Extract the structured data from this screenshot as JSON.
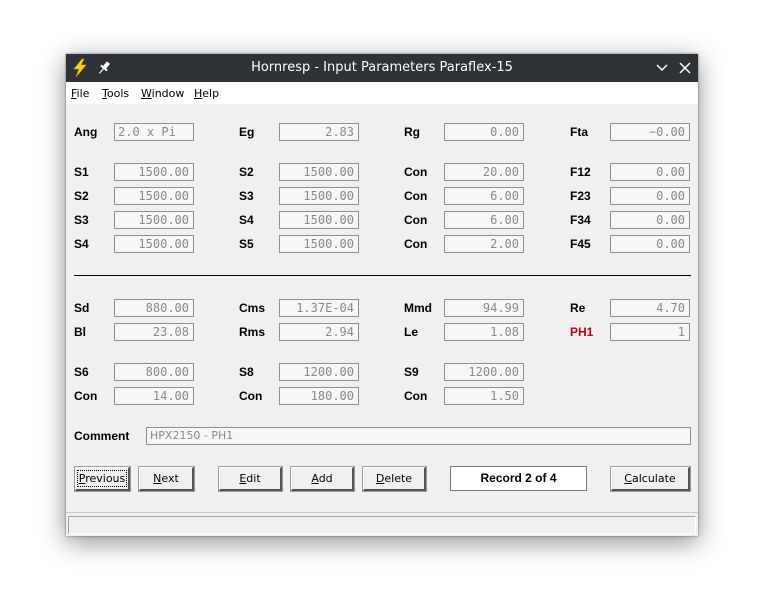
{
  "window": {
    "title": "Hornresp - Input Parameters Paraflex-15",
    "app_icon": "lightning-icon",
    "pin_icon": "pin-icon",
    "minimize_icon": "chevron-down-icon",
    "close_icon": "close-icon"
  },
  "menu": {
    "file": {
      "u": "F",
      "rest": "ile"
    },
    "tools": {
      "u": "T",
      "rest": "ools"
    },
    "window": {
      "u": "W",
      "rest": "indow"
    },
    "help": {
      "u": "H",
      "rest": "elp"
    }
  },
  "params": {
    "row1": [
      {
        "label": "Ang",
        "value": "2.0 x Pi"
      },
      {
        "label": "Eg",
        "value": "2.83"
      },
      {
        "label": "Rg",
        "value": "0.00"
      },
      {
        "label": "Fta",
        "value": "−0.00"
      }
    ],
    "row2": [
      {
        "label": "S1",
        "value": "1500.00"
      },
      {
        "label": "S2",
        "value": "1500.00"
      },
      {
        "label": "Con",
        "value": "20.00"
      },
      {
        "label": "F12",
        "value": "0.00"
      }
    ],
    "row3": [
      {
        "label": "S2",
        "value": "1500.00"
      },
      {
        "label": "S3",
        "value": "1500.00"
      },
      {
        "label": "Con",
        "value": "6.00"
      },
      {
        "label": "F23",
        "value": "0.00"
      }
    ],
    "row4": [
      {
        "label": "S3",
        "value": "1500.00"
      },
      {
        "label": "S4",
        "value": "1500.00"
      },
      {
        "label": "Con",
        "value": "6.00"
      },
      {
        "label": "F34",
        "value": "0.00"
      }
    ],
    "row5": [
      {
        "label": "S4",
        "value": "1500.00"
      },
      {
        "label": "S5",
        "value": "1500.00"
      },
      {
        "label": "Con",
        "value": "2.00"
      },
      {
        "label": "F45",
        "value": "0.00"
      }
    ],
    "row6": [
      {
        "label": "Sd",
        "value": "880.00"
      },
      {
        "label": "Cms",
        "value": "1.37E-04"
      },
      {
        "label": "Mmd",
        "value": "94.99"
      },
      {
        "label": "Re",
        "value": "4.70"
      }
    ],
    "row7": [
      {
        "label": "Bl",
        "value": "23.08"
      },
      {
        "label": "Rms",
        "value": "2.94"
      },
      {
        "label": "Le",
        "value": "1.08"
      },
      {
        "label": "PH1",
        "value": "1"
      }
    ],
    "row8": [
      {
        "label": "S6",
        "value": "800.00"
      },
      {
        "label": "S8",
        "value": "1200.00"
      },
      {
        "label": "S9",
        "value": "1200.00"
      }
    ],
    "row9": [
      {
        "label": "Con",
        "value": "14.00"
      },
      {
        "label": "Con",
        "value": "180.00"
      },
      {
        "label": "Con",
        "value": "1.50"
      }
    ]
  },
  "comment": {
    "label": "Comment",
    "value": "HPX2150 - PH1"
  },
  "buttons": {
    "previous": {
      "u": "P",
      "rest": "revious"
    },
    "next": {
      "u": "N",
      "rest": "ext"
    },
    "edit": {
      "u": "E",
      "rest": "dit"
    },
    "add": {
      "u": "A",
      "rest": "dd"
    },
    "delete": {
      "u": "D",
      "rest": "elete"
    },
    "calculate": {
      "u": "C",
      "rest": "alculate"
    }
  },
  "record": "Record 2 of 4",
  "colors": {
    "titlebar": "#2f3337",
    "highlight_label": "#c00000"
  }
}
